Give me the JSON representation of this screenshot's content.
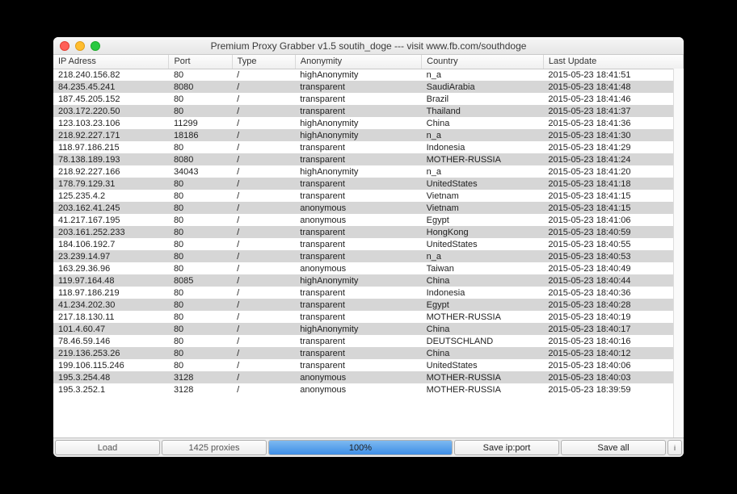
{
  "window": {
    "title": "Premium Proxy Grabber v1.5 soutih_doge --- visit www.fb.com/southdoge"
  },
  "columns": {
    "ip": "IP Adress",
    "port": "Port",
    "type": "Type",
    "anon": "Anonymity",
    "country": "Country",
    "update": "Last Update"
  },
  "rows": [
    {
      "ip": "218.240.156.82",
      "port": "80",
      "type": "/",
      "anon": "highAnonymity",
      "country": "n_a",
      "update": "2015-05-23 18:41:51"
    },
    {
      "ip": "84.235.45.241",
      "port": "8080",
      "type": "/",
      "anon": "transparent",
      "country": "SaudiArabia",
      "update": "2015-05-23 18:41:48"
    },
    {
      "ip": "187.45.205.152",
      "port": "80",
      "type": "/",
      "anon": "transparent",
      "country": "Brazil",
      "update": "2015-05-23 18:41:46"
    },
    {
      "ip": "203.172.220.50",
      "port": "80",
      "type": "/",
      "anon": "transparent",
      "country": "Thailand",
      "update": "2015-05-23 18:41:37"
    },
    {
      "ip": "123.103.23.106",
      "port": "11299",
      "type": "/",
      "anon": "highAnonymity",
      "country": "China",
      "update": "2015-05-23 18:41:36"
    },
    {
      "ip": "218.92.227.171",
      "port": "18186",
      "type": "/",
      "anon": "highAnonymity",
      "country": "n_a",
      "update": "2015-05-23 18:41:30"
    },
    {
      "ip": "118.97.186.215",
      "port": "80",
      "type": "/",
      "anon": "transparent",
      "country": "Indonesia",
      "update": "2015-05-23 18:41:29"
    },
    {
      "ip": "78.138.189.193",
      "port": "8080",
      "type": "/",
      "anon": "transparent",
      "country": "MOTHER-RUSSIA",
      "update": "2015-05-23 18:41:24"
    },
    {
      "ip": "218.92.227.166",
      "port": "34043",
      "type": "/",
      "anon": "highAnonymity",
      "country": "n_a",
      "update": "2015-05-23 18:41:20"
    },
    {
      "ip": "178.79.129.31",
      "port": "80",
      "type": "/",
      "anon": "transparent",
      "country": "UnitedStates",
      "update": "2015-05-23 18:41:18"
    },
    {
      "ip": "125.235.4.2",
      "port": "80",
      "type": "/",
      "anon": "transparent",
      "country": "Vietnam",
      "update": "2015-05-23 18:41:15"
    },
    {
      "ip": "203.162.41.245",
      "port": "80",
      "type": "/",
      "anon": "anonymous",
      "country": "Vietnam",
      "update": "2015-05-23 18:41:15"
    },
    {
      "ip": "41.217.167.195",
      "port": "80",
      "type": "/",
      "anon": "anonymous",
      "country": "Egypt",
      "update": "2015-05-23 18:41:06"
    },
    {
      "ip": "203.161.252.233",
      "port": "80",
      "type": "/",
      "anon": "transparent",
      "country": "HongKong",
      "update": "2015-05-23 18:40:59"
    },
    {
      "ip": "184.106.192.7",
      "port": "80",
      "type": "/",
      "anon": "transparent",
      "country": "UnitedStates",
      "update": "2015-05-23 18:40:55"
    },
    {
      "ip": "23.239.14.97",
      "port": "80",
      "type": "/",
      "anon": "transparent",
      "country": "n_a",
      "update": "2015-05-23 18:40:53"
    },
    {
      "ip": "163.29.36.96",
      "port": "80",
      "type": "/",
      "anon": "anonymous",
      "country": "Taiwan",
      "update": "2015-05-23 18:40:49"
    },
    {
      "ip": "119.97.164.48",
      "port": "8085",
      "type": "/",
      "anon": "highAnonymity",
      "country": "China",
      "update": "2015-05-23 18:40:44"
    },
    {
      "ip": "118.97.186.219",
      "port": "80",
      "type": "/",
      "anon": "transparent",
      "country": "Indonesia",
      "update": "2015-05-23 18:40:36"
    },
    {
      "ip": "41.234.202.30",
      "port": "80",
      "type": "/",
      "anon": "transparent",
      "country": "Egypt",
      "update": "2015-05-23 18:40:28"
    },
    {
      "ip": "217.18.130.11",
      "port": "80",
      "type": "/",
      "anon": "transparent",
      "country": "MOTHER-RUSSIA",
      "update": "2015-05-23 18:40:19"
    },
    {
      "ip": "101.4.60.47",
      "port": "80",
      "type": "/",
      "anon": "highAnonymity",
      "country": "China",
      "update": "2015-05-23 18:40:17"
    },
    {
      "ip": "78.46.59.146",
      "port": "80",
      "type": "/",
      "anon": "transparent",
      "country": "DEUTSCHLAND",
      "update": "2015-05-23 18:40:16"
    },
    {
      "ip": "219.136.253.26",
      "port": "80",
      "type": "/",
      "anon": "transparent",
      "country": "China",
      "update": "2015-05-23 18:40:12"
    },
    {
      "ip": "199.106.115.246",
      "port": "80",
      "type": "/",
      "anon": "transparent",
      "country": "UnitedStates",
      "update": "2015-05-23 18:40:06"
    },
    {
      "ip": "195.3.254.48",
      "port": "3128",
      "type": "/",
      "anon": "anonymous",
      "country": "MOTHER-RUSSIA",
      "update": "2015-05-23 18:40:03"
    },
    {
      "ip": "195.3.252.1",
      "port": "3128",
      "type": "/",
      "anon": "anonymous",
      "country": "MOTHER-RUSSIA",
      "update": "2015-05-23 18:39:59"
    }
  ],
  "bottom": {
    "load": "Load",
    "status": "1425 proxies",
    "progress": "100%",
    "save_ipport": "Save ip:port",
    "save_all": "Save all",
    "info": "i"
  }
}
